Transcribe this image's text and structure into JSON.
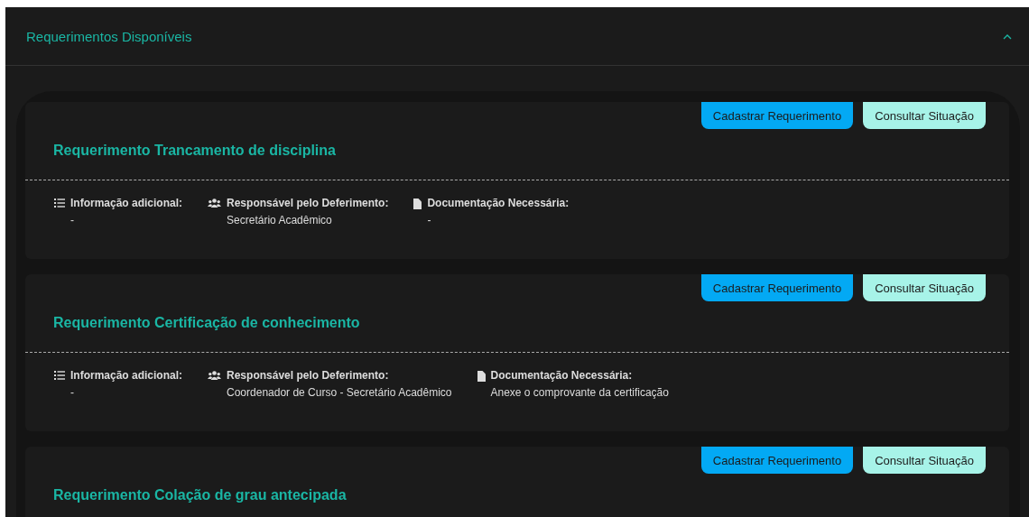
{
  "panel": {
    "title": "Requerimentos Disponíveis",
    "expanded": true
  },
  "cards": [
    {
      "title": "Requerimento Trancamento de disciplina",
      "buttons": [
        {
          "kind": "primary",
          "label": "Cadastrar Requerimento"
        },
        {
          "kind": "secondary",
          "label": "Consultar Situação"
        }
      ],
      "details": [
        {
          "kind": "info",
          "label": "Informação adicional:",
          "value": "-"
        },
        {
          "kind": "responsible",
          "label": "Responsável pelo Deferimento:",
          "value": "Secretário Acadêmico"
        },
        {
          "kind": "docs",
          "label": "Documentação Necessária:",
          "value": "-"
        }
      ]
    },
    {
      "title": "Requerimento Certificação de conhecimento",
      "buttons": [
        {
          "kind": "primary",
          "label": "Cadastrar Requerimento"
        },
        {
          "kind": "secondary",
          "label": "Consultar Situação"
        }
      ],
      "details": [
        {
          "kind": "info",
          "label": "Informação adicional:",
          "value": "-"
        },
        {
          "kind": "responsible",
          "label": "Responsável pelo Deferimento:",
          "value": "Coordenador de Curso - Secretário Acadêmico"
        },
        {
          "kind": "docs",
          "label": "Documentação Necessária:",
          "value": "Anexe o comprovante da certificação"
        }
      ]
    },
    {
      "title": "Requerimento Colação de grau antecipada",
      "buttons": [
        {
          "kind": "primary",
          "label": "Cadastrar Requerimento"
        },
        {
          "kind": "secondary",
          "label": "Consultar Situação"
        }
      ]
    }
  ]
}
